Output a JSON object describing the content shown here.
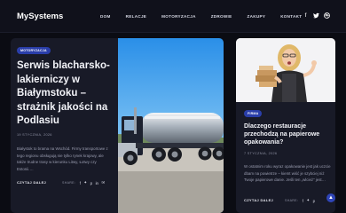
{
  "site": {
    "logo": "MySystems",
    "nav": [
      "DOM",
      "RELACJE",
      "MOTORYZACJA",
      "ZDROWIE",
      "ZAKUPY",
      "KONTAKT"
    ],
    "social_icons": [
      "facebook-icon",
      "twitter-icon",
      "dribbble-icon"
    ]
  },
  "featured": {
    "category": "MOTORYZACJA",
    "title": "Serwis blacharsko-lakierniczy w Białymstoku – strażnik jakości na Podlasiu",
    "date": "19 STYCZNIA, 2026",
    "excerpt": "Białystok to brama na Wschód. Firmy transportowe z tego regionu obsługują nie tylko rynek krajowy, ale także trudne trasy w kierunku Litwy, Łotwy czy Estonii.…",
    "read_more": "CZYTAJ DALEJ",
    "share_label": "SHARE:",
    "image_desc": "tanker-truck-photo"
  },
  "side": {
    "category": "FIRMA",
    "title": "Dlaczego restauracje przechodzą na papierowe opakowania?",
    "date": "7 STYCZNIA, 2026",
    "excerpt": "W ostatnim roku wyraz opakowanie jest jak uczcie dbam na powietrze – kiemt wiść je szybciej niż Twoje papierowe danie. Jeśli ten „wlcież” jest…",
    "read_more": "CZYTAJ DALEJ",
    "share_label": "SHARE:",
    "image_desc": "woman-with-boxes-photo"
  },
  "colors": {
    "accent": "#2a3ea9",
    "bg": "#0b0c13",
    "card": "#181a27"
  }
}
